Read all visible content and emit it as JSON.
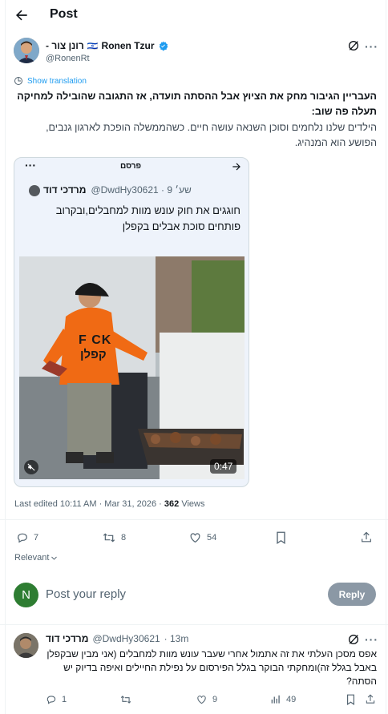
{
  "header": {
    "title": "Post"
  },
  "post": {
    "author_name_he": "רונן צור -",
    "author_flag": "🇮🇱",
    "author_name_en": "Ronen Tzur",
    "handle": "@RonenRt",
    "translation_label": "Show translation",
    "text_bold": "העבריין הגיבור מחק את הציוץ אבל ההסתה תועדה, אז התגובה שהובילה למחיקה תעלה פה שוב:",
    "text_body": "הילדים שלנו נלחמים וסוכן השנאה עושה חיים. כשהממשלה הופכת לארגון גנבים, הפושע הוא המנהיג.",
    "meta_edit": "Last edited 10:11 AM · Mar 31, 2026 · ",
    "meta_views_count": "362",
    "meta_views_label": " Views",
    "stats": {
      "replies": "7",
      "reposts": "8",
      "likes": "54"
    }
  },
  "embed": {
    "label": "פרסם",
    "author_name": "מרדכי דוד",
    "handle_time": "@DwdHy30621 · 9 שע׳",
    "text": "חוגגים את חוק עונש מוות למחבלים,ובקרוב פותחים סוכת אבלים בקפלן",
    "video_duration": "0:47",
    "shirt_text_1": "F CK",
    "shirt_text_2": "קפלן"
  },
  "sort": {
    "label": "Relevant"
  },
  "reply_composer": {
    "avatar_letter": "N",
    "placeholder": "Post your reply",
    "button_label": "Reply"
  },
  "reply": {
    "author_name": "מרדכי דוד",
    "handle": "@DwdHy30621",
    "time": "· 13m",
    "text": "אפס מסכן העלתי את זה אתמול אחרי שעבר עונש מוות למחבלים (אני מבין שבקפלן באבל בגלל זה)ומחקתי הבוקר בגלל הפירסום על נפילת החיילים ואיפה בדיוק יש הסתה?",
    "stats": {
      "replies": "1",
      "reposts": "",
      "likes": "9",
      "views": "49"
    }
  },
  "colors": {
    "accent": "#1d9bf0",
    "text": "#0f1419",
    "muted": "#536471",
    "border": "#eff3f4",
    "reply_button_bg": "#8b98a5",
    "avatar_green": "#2e7d32"
  }
}
